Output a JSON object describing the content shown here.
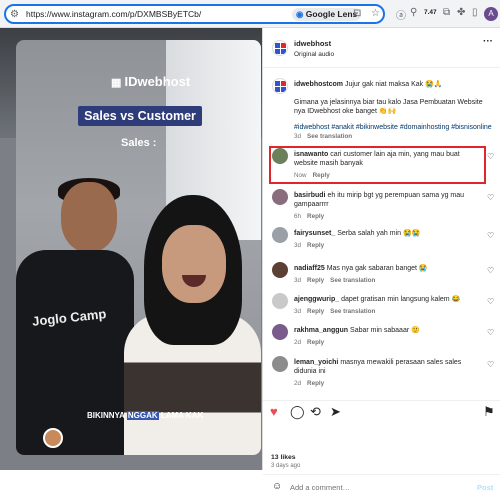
{
  "browser": {
    "url": "https://www.instagram.com/p/DXMBSByETCb/",
    "lens_label": "Google Lens",
    "extension_badge": "7.47"
  },
  "video": {
    "brand": "IDwebhost",
    "title": "Sales vs Customer",
    "sales_label": "Sales :",
    "caption_before": "BIKINNYA ",
    "caption_highlight": "NGGAK",
    "caption_after": " LAMA KAK",
    "shirt_text": "Joglo Camp"
  },
  "post": {
    "username": "idwebhost",
    "audio": "Original audio",
    "caption": {
      "username": "idwebhostcom",
      "line1": "Jujur gak niat maksa Kak 😭🙏",
      "line2": "Gimana ya jelasinnya biar tau kalo Jasa Pembuatan Website nya IDwebhost oke banget 👏🙌",
      "hashtags": "#idwebhost #anakit #bikinwebsite #domainhosting #bisnisonline",
      "time": "3d",
      "translation": "See translation"
    },
    "comments": [
      {
        "username": "isnawanto",
        "text": "cari customer lain aja min, yang mau buat website masih banyak",
        "time": "Now",
        "reply": "Reply",
        "translation": "",
        "avatar_color": "#6b7f5a"
      },
      {
        "username": "basirbudi",
        "text": "eh itu mirip bgt yg perempuan sama yg mau gampaarrrr",
        "time": "6h",
        "reply": "Reply",
        "translation": "",
        "avatar_color": "#8a6d7c"
      },
      {
        "username": "fairysunset_",
        "text": "Serba salah yah min 😭😭",
        "time": "3d",
        "reply": "Reply",
        "translation": "",
        "avatar_color": "#9aa0a6"
      },
      {
        "username": "nadiaff25",
        "text": "Mas nya gak sabaran banget 😭",
        "time": "3d",
        "reply": "Reply",
        "translation": "See translation",
        "avatar_color": "#5c4033"
      },
      {
        "username": "ajenggwurip_",
        "text": "dapet gratisan min langsung kalem 😂",
        "time": "3d",
        "reply": "Reply",
        "translation": "See translation",
        "avatar_color": "#c9c9c9"
      },
      {
        "username": "rakhma_anggun",
        "text": "Sabar min sabaaar 🙂",
        "time": "2d",
        "reply": "Reply",
        "translation": "",
        "avatar_color": "#7a5c8c"
      },
      {
        "username": "leman_yoichi",
        "text": "masnya mewakili perasaan sales sales didunia ini",
        "time": "2d",
        "reply": "Reply",
        "translation": "",
        "avatar_color": "#8c8c8c"
      }
    ],
    "likes": "13 likes",
    "posted": "3 days ago",
    "add_comment_placeholder": "Add a comment…",
    "post_label": "Post"
  }
}
